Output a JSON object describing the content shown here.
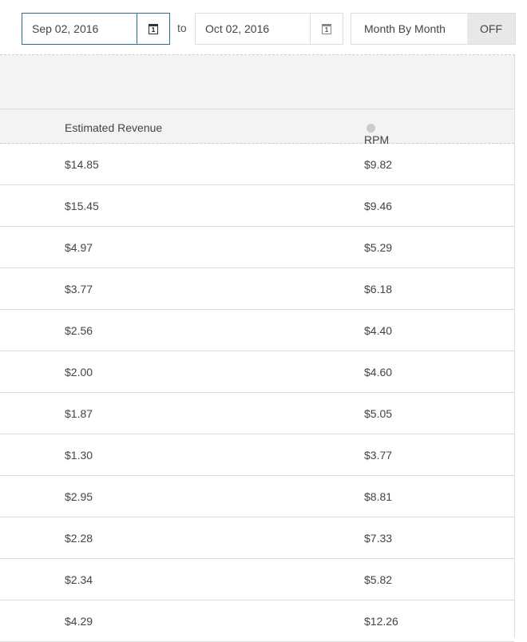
{
  "date_range": {
    "start": "Sep 02, 2016",
    "separator": "to",
    "end": "Oct 02, 2016",
    "calendar_icon_day": "1"
  },
  "month_toggle": {
    "label": "Month By Month",
    "state": "OFF"
  },
  "table": {
    "columns": [
      "Estimated Revenue",
      "RPM"
    ],
    "rows": [
      [
        "$14.85",
        "$9.82"
      ],
      [
        "$15.45",
        "$9.46"
      ],
      [
        "$4.97",
        "$5.29"
      ],
      [
        "$3.77",
        "$6.18"
      ],
      [
        "$2.56",
        "$4.40"
      ],
      [
        "$2.00",
        "$4.60"
      ],
      [
        "$1.87",
        "$5.05"
      ],
      [
        "$1.30",
        "$3.77"
      ],
      [
        "$2.95",
        "$8.81"
      ],
      [
        "$2.28",
        "$7.33"
      ],
      [
        "$2.34",
        "$5.82"
      ],
      [
        "$4.29",
        "$12.26"
      ]
    ]
  },
  "colors": {
    "accent_border": "#2a6f8f",
    "header_bg": "#f3f3f3"
  }
}
